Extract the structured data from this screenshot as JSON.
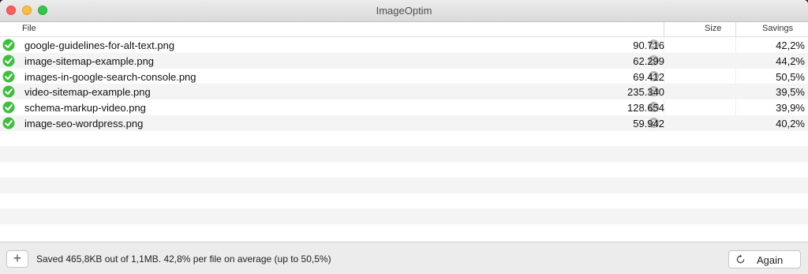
{
  "window": {
    "title": "ImageOptim"
  },
  "columns": {
    "file": "File",
    "size": "Size",
    "savings": "Savings"
  },
  "files": [
    {
      "name": "google-guidelines-for-alt-text.png",
      "size": "90.716",
      "savings": "42,2%"
    },
    {
      "name": "image-sitemap-example.png",
      "size": "62.299",
      "savings": "44,2%"
    },
    {
      "name": "images-in-google-search-console.png",
      "size": "69.412",
      "savings": "50,5%"
    },
    {
      "name": "video-sitemap-example.png",
      "size": "235.340",
      "savings": "39,5%"
    },
    {
      "name": "schema-markup-video.png",
      "size": "128.654",
      "savings": "39,9%"
    },
    {
      "name": "image-seo-wordpress.png",
      "size": "59.942",
      "savings": "40,2%"
    }
  ],
  "footer": {
    "add_label": "+",
    "status": "Saved 465,8KB out of 1,1MB. 42,8% per file on average (up to 50,5%)",
    "again_label": "Again"
  },
  "colors": {
    "check_green": "#3fbf3f",
    "close": "#fc605c",
    "minimize": "#fdbc40",
    "maximize": "#34c84a"
  },
  "icons": {
    "status": "checkmark-circle-icon",
    "quicklook": "magnifier-icon",
    "again": "refresh-icon"
  }
}
